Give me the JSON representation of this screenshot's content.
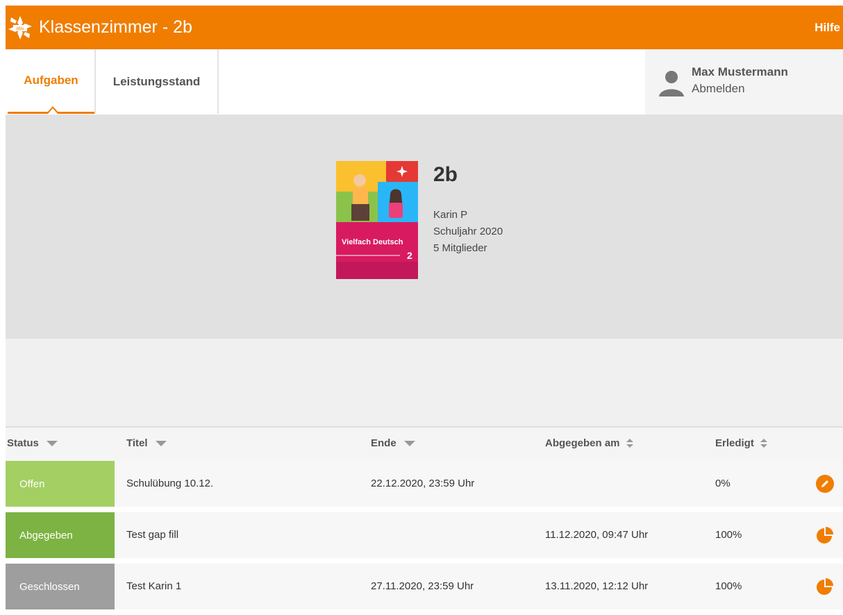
{
  "header": {
    "title": "Klassenzimmer - 2b",
    "help": "Hilfe",
    "logo_text": "öbv"
  },
  "colors": {
    "brand": "#f07d00",
    "offen": "#a3cf63",
    "abgegeben": "#7cb342",
    "geschlossen": "#9e9e9e"
  },
  "nav": {
    "tabs": [
      {
        "label": "Aufgaben",
        "active": true
      },
      {
        "label": "Leistungsstand",
        "active": false
      }
    ]
  },
  "user": {
    "name": "Max Mustermann",
    "logout": "Abmelden",
    "icon": "user-icon"
  },
  "classroom": {
    "name": "2b",
    "teacher": "Karin P",
    "year": "Schuljahr 2020",
    "members": "5 Mitglieder",
    "book_title": "Vielfach Deutsch",
    "book_number": "2"
  },
  "table": {
    "headers": [
      {
        "label": "Status",
        "sort": "desc"
      },
      {
        "label": "Titel",
        "sort": "desc"
      },
      {
        "label": "Ende",
        "sort": "desc"
      },
      {
        "label": "Abgegeben am",
        "sort": "none"
      },
      {
        "label": "Erledigt",
        "sort": "none"
      }
    ],
    "rows": [
      {
        "status": "Offen",
        "title": "Schulübung 10.12.",
        "end": "22.12.2020, 23:59 Uhr",
        "submitted": "",
        "done": "0%",
        "action_icon": "pencil-icon"
      },
      {
        "status": "Abgegeben",
        "title": "Test gap fill",
        "end": "",
        "submitted": "11.12.2020, 09:47 Uhr",
        "done": "100%",
        "action_icon": "pie-chart-icon"
      },
      {
        "status": "Geschlossen",
        "title": "Test Karin 1",
        "end": "27.11.2020, 23:59 Uhr",
        "submitted": "13.11.2020, 12:12 Uhr",
        "done": "100%",
        "action_icon": "pie-chart-icon"
      }
    ]
  }
}
